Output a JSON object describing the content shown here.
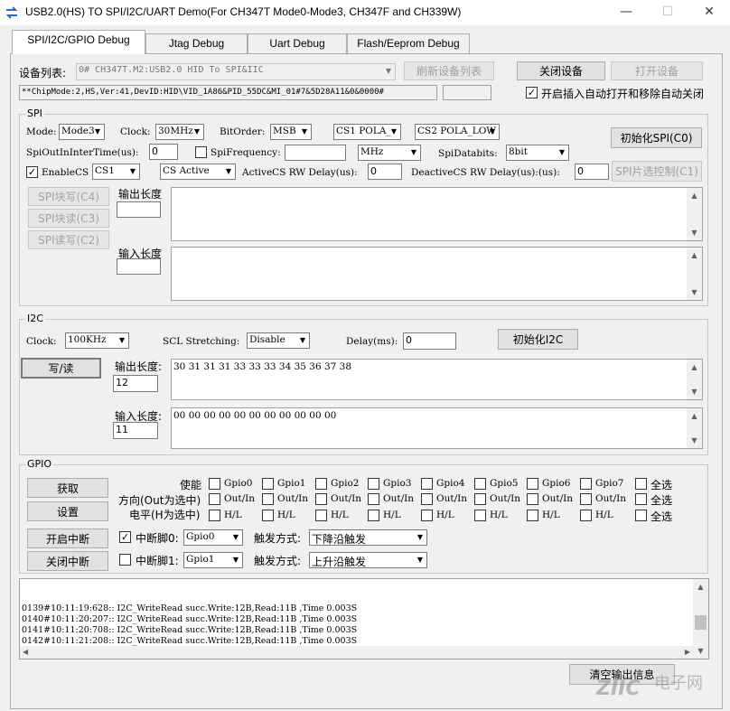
{
  "window": {
    "title": "USB2.0(HS) TO SPI/I2C/UART Demo(For CH347T Mode0-Mode3, CH347F and CH339W)",
    "minimize": "—",
    "maximize": "☐",
    "close": "✕"
  },
  "tabs": [
    "SPI/I2C/GPIO Debug",
    "Jtag Debug",
    "Uart Debug",
    "Flash/Eeprom Debug"
  ],
  "device": {
    "list_label": "设备列表:",
    "selected": "0# CH347T.M2:USB2.0 HID To SPI&IIC",
    "refresh_button": "刷新设备列表",
    "close_button": "关闭设备",
    "open_button": "打开设备",
    "info": "**ChipMode:2,HS,Ver:41,DevID:HID\\VID_1A86&PID_55DC&MI_01#7&5D28A11&0&0000#",
    "auto_label": "开启插入自动打开和移除自动关闭",
    "auto_checked": true
  },
  "spi": {
    "group_title": "SPI",
    "mode_label": "Mode:",
    "mode_value": "Mode3",
    "clock_label": "Clock:",
    "clock_value": "30MHz",
    "bitorder_label": "BitOrder:",
    "bitorder_value": "MSB",
    "cs1_pola": "CS1 POLA_",
    "cs2_pola": "CS2 POLA_LOW",
    "init_button": "初始化SPI(C0)",
    "interval_label": "SpiOutInInterTime(us):",
    "interval_value": "0",
    "freq_label": "SpiFrequency:",
    "freq_value": "",
    "freq_unit": "MHz",
    "databits_label": "SpiDatabits:",
    "databits_value": "8bit",
    "enablecs_label": "EnableCS",
    "cs_value": "CS1",
    "cs_active": "CS Active",
    "active_delay_label": "ActiveCS RW Delay(us):",
    "active_delay_value": "0",
    "deactive_delay_label": "DeactiveCS RW Delay(us):(us):",
    "deactive_delay_value": "0",
    "cs_ctrl_button": "SPI片选控制(C1)",
    "write_button": "SPI块写(C4)",
    "read_button": "SPI块读(C3)",
    "rw_button": "SPI读写(C2)",
    "out_len_label": "输出长度",
    "out_len_value": "",
    "in_len_label": "输入长度",
    "in_len_value": "",
    "out_data": "",
    "in_data": ""
  },
  "i2c": {
    "group_title": "I2C",
    "clock_label": "Clock:",
    "clock_value": "100KHz",
    "stretch_label": "SCL Stretching:",
    "stretch_value": "Disable",
    "delay_label": "Delay(ms):",
    "delay_value": "0",
    "init_button": "初始化I2C",
    "rw_button": "写/读",
    "out_len_label": "输出长度:",
    "out_len_value": "12",
    "in_len_label": "输入长度:",
    "in_len_value": "11",
    "out_data": "30 31 31 31 33 33 33 34 35 36 37 38",
    "in_data": "00 00 00 00 00 00 00 00 00 00 00"
  },
  "gpio": {
    "group_title": "GPIO",
    "get_button": "获取",
    "set_button": "设置",
    "int_on_button": "开启中断",
    "int_off_button": "关闭中断",
    "enable_label": "使能",
    "dir_label": "方向(Out为选中)",
    "level_label": "电平(H为选中)",
    "pins": [
      "Gpio0",
      "Gpio1",
      "Gpio2",
      "Gpio3",
      "Gpio4",
      "Gpio5",
      "Gpio6",
      "Gpio7"
    ],
    "select_all": "全选",
    "dir_text": "Out/In",
    "level_text": "H/L",
    "int0_label": "中断脚0:",
    "int0_pin": "Gpio0",
    "int0_checked": true,
    "int1_label": "中断脚1:",
    "int1_pin": "Gpio1",
    "int1_checked": false,
    "trigger_label": "触发方式:",
    "trigger0": "下降沿触发",
    "trigger1": "上升沿触发"
  },
  "log": {
    "lines": [
      "0139#10:11:19:628:: I2C_WriteRead succ.Write:12B,Read:11B ,Time 0.003S",
      "0140#10:11:20:207:: I2C_WriteRead succ.Write:12B,Read:11B ,Time 0.003S",
      "0141#10:11:20:708:: I2C_WriteRead succ.Write:12B,Read:11B ,Time 0.003S",
      "0142#10:11:21:208:: I2C_WriteRead succ.Write:12B,Read:11B ,Time 0.003S"
    ],
    "clear_button": "清空输出信息"
  },
  "watermark": "电子网"
}
